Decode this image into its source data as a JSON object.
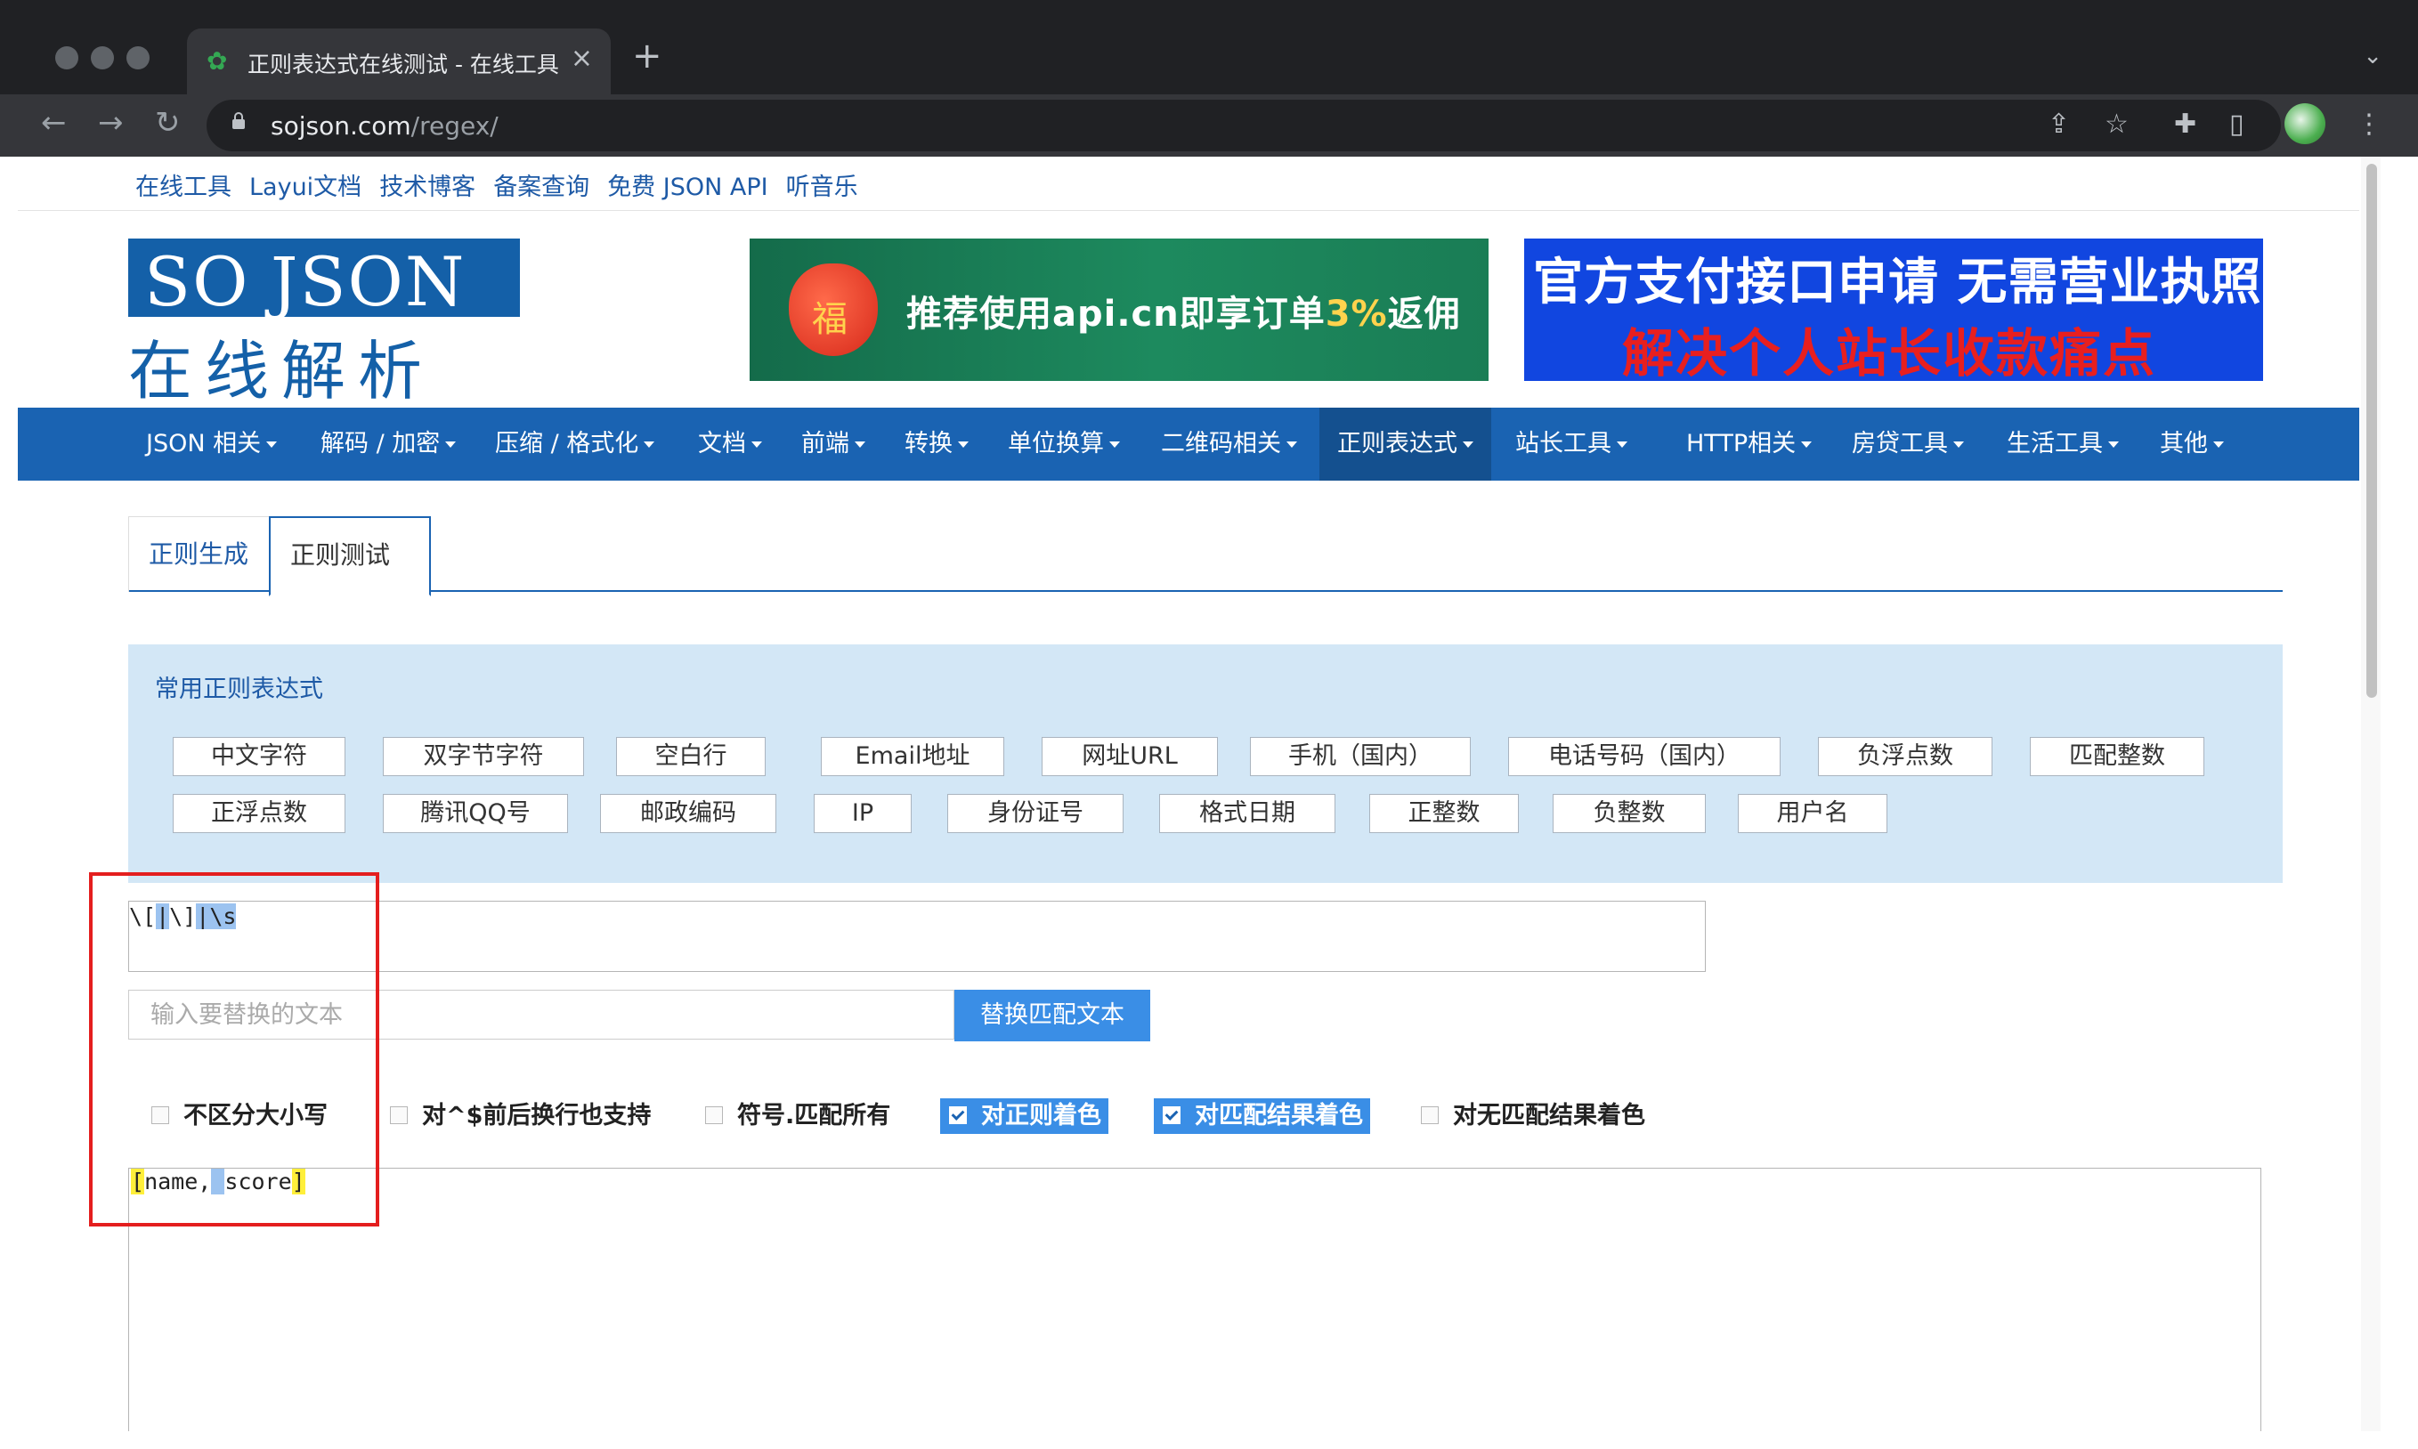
{
  "browser": {
    "tab_title": "正则表达式在线测试 - 在线工具",
    "url_host": "sojson.com",
    "url_path": "/regex/",
    "new_tab": "+",
    "close": "×"
  },
  "toplinks": [
    "在线工具",
    "Layui文档",
    "技术博客",
    "备案查询",
    "免费 JSON API",
    "听音乐"
  ],
  "logo": {
    "top_left": "SO",
    "top_right": "JSON",
    "bottom": "在线解析"
  },
  "banner1": {
    "bag_char": "福",
    "text_before": "推荐使用api.cn即享订单",
    "text_highlight": "3%",
    "text_after": "返佣"
  },
  "banner2": {
    "line1": "官方支付接口申请 无需营业执照",
    "line2": "解决个人站长收款痛点"
  },
  "navbar": [
    "JSON 相关",
    "解码 / 加密",
    "压缩 / 格式化",
    "文档",
    "前端",
    "转换",
    "单位换算",
    "二维码相关",
    "正则表达式",
    "站长工具",
    "HTTP相关",
    "房贷工具",
    "生活工具",
    "其他"
  ],
  "navbar_active": "正则表达式",
  "tabs": {
    "gen": "正则生成",
    "test": "正则测试"
  },
  "common": {
    "heading": "常用正则表达式",
    "row1": [
      "中文字符",
      "双字节字符",
      "空白行",
      "Email地址",
      "网址URL",
      "手机（国内）",
      "电话号码（国内）",
      "负浮点数",
      "匹配整数"
    ],
    "row2": [
      "正浮点数",
      "腾讯QQ号",
      "邮政编码",
      "IP",
      "身份证号",
      "格式日期",
      "正整数",
      "负整数",
      "用户名"
    ]
  },
  "regex": {
    "p1": "\\[",
    "p2": "|",
    "p3": "\\]",
    "p4": "|\\s"
  },
  "replace": {
    "placeholder": "输入要替换的文本",
    "button": "替换匹配文本"
  },
  "options": [
    {
      "label": "不区分大小写",
      "checked": false
    },
    {
      "label": "对^$前后换行也支持",
      "checked": false
    },
    {
      "label": "符号.匹配所有",
      "checked": false
    },
    {
      "label": "对正则着色",
      "checked": true
    },
    {
      "label": "对匹配结果着色",
      "checked": true
    },
    {
      "label": "对无匹配结果着色",
      "checked": false
    }
  ],
  "result": {
    "m1": "[",
    "t1": "name,",
    "m2": " ",
    "t2": "score",
    "m3": "]"
  },
  "colors": {
    "nav_blue": "#1a63b2",
    "match_yellow": "#ffef3a",
    "match_blue": "#9cc3f0",
    "annotation_red": "#e41e1e"
  }
}
